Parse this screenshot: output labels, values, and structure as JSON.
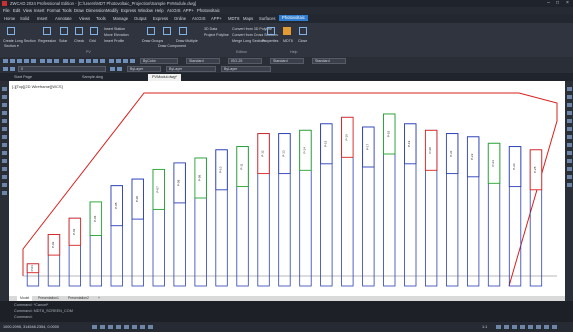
{
  "window": {
    "title": "ZWCAD 2024 Professional Edition - [C:\\Users\\MDT Photovoltaic_Projection\\Sample PVModule.dwg]",
    "controls": [
      "–",
      "□",
      "×"
    ]
  },
  "menubar": [
    "File",
    "Edit",
    "View",
    "Insert",
    "Format",
    "Tools",
    "Draw",
    "Dimension",
    "Modify",
    "Express",
    "Window",
    "Help",
    "ArcGIS",
    "APP+",
    "Photovoltaic"
  ],
  "ribbon_tabs": [
    "Home",
    "Solid",
    "Insert",
    "Annotate",
    "Views",
    "Tools",
    "Manage",
    "Output",
    "Express",
    "Online",
    "ArcGIS",
    "APP+",
    "MDT8",
    "Maps",
    "Surfaces",
    "Photovoltaic"
  ],
  "ribbon_active_tab": "Photovoltaic",
  "ribbon": {
    "buttons": [
      {
        "label": "Create Long Section",
        "sub": "Section ▾"
      },
      {
        "label": "Regression"
      },
      {
        "label": "Solar"
      },
      {
        "label": "Check"
      },
      {
        "label": "Grid"
      },
      {
        "label": "Insert Station"
      },
      {
        "label": "Move Elevation"
      },
      {
        "label": "Insert Profile"
      },
      {
        "label": "Draw Groups"
      },
      {
        "label": "Draw Component"
      },
      {
        "label": "Draw Multiple"
      },
      {
        "label": "3D Data"
      },
      {
        "label": "Project Polyline"
      },
      {
        "label": "Convert from 3D Polyline"
      },
      {
        "label": "Convert from Cross Sections"
      },
      {
        "label": "Merge Long Sections"
      },
      {
        "label": "Properties"
      },
      {
        "label": "MDT8"
      },
      {
        "label": "Close"
      }
    ],
    "groups": [
      "PV",
      "Edition",
      "Help"
    ]
  },
  "toolbar": {
    "layer_combo": "0",
    "color_combo": "ByLayer",
    "linetype_combo": "ByLayer",
    "lineweight_combo": "ByLayer",
    "plot_combo": "ByColor",
    "style_combo": "Standard",
    "dim_combo": "ISO-25",
    "table_combo": "Standard",
    "ml_combo": "Standard"
  },
  "doc_tabs": [
    "Start Page",
    "Sample.dwg",
    "PVModul.dwg*"
  ],
  "active_doc_tab": "PVModul.dwg*",
  "view_label": "[-][Top][2D Wireframe][WCS]",
  "layout_tabs": [
    "Model",
    "Presentation1",
    "Presentation2",
    "+"
  ],
  "active_layout_tab": "Model",
  "command_lines": [
    "Command:  *Cancel*",
    "Command:  MDT8_SCREEN_COM",
    "Command:"
  ],
  "status": {
    "coords": "1000.2095, 314548.2354, 0.0000",
    "scale": "1:1"
  },
  "colors": {
    "canvas_bg": "#ffffff",
    "table_blue": "#2a3fb8",
    "table_green": "#22a32a",
    "table_red": "#d8201c",
    "boundary": "#d8201c",
    "accent": "#2e7bcf"
  },
  "panels": [
    {
      "h": 0.0,
      "c": "red",
      "id": "P-01"
    },
    {
      "h": 0.18,
      "c": "red",
      "id": "P-02"
    },
    {
      "h": 0.28,
      "c": "red",
      "id": "P-03"
    },
    {
      "h": 0.38,
      "c": "green",
      "id": "P-04"
    },
    {
      "h": 0.48,
      "c": "blue",
      "id": "P-05"
    },
    {
      "h": 0.52,
      "c": "blue",
      "id": "P-06"
    },
    {
      "h": 0.58,
      "c": "green",
      "id": "P-07"
    },
    {
      "h": 0.62,
      "c": "blue",
      "id": "P-08"
    },
    {
      "h": 0.65,
      "c": "green",
      "id": "P-09"
    },
    {
      "h": 0.7,
      "c": "blue",
      "id": "P-10"
    },
    {
      "h": 0.72,
      "c": "green",
      "id": "P-11"
    },
    {
      "h": 0.8,
      "c": "red",
      "id": "P-12"
    },
    {
      "h": 0.8,
      "c": "blue",
      "id": "P-13"
    },
    {
      "h": 0.82,
      "c": "green",
      "id": "P-14"
    },
    {
      "h": 0.86,
      "c": "blue",
      "id": "P-15"
    },
    {
      "h": 0.9,
      "c": "red",
      "id": "P-16"
    },
    {
      "h": 0.84,
      "c": "blue",
      "id": "P-17"
    },
    {
      "h": 0.92,
      "c": "green",
      "id": "P-18"
    },
    {
      "h": 0.86,
      "c": "blue",
      "id": "P-19"
    },
    {
      "h": 0.82,
      "c": "red",
      "id": "P-20"
    },
    {
      "h": 0.8,
      "c": "blue",
      "id": "P-21"
    },
    {
      "h": 0.78,
      "c": "blue",
      "id": "P-22"
    },
    {
      "h": 0.74,
      "c": "green",
      "id": "P-23"
    },
    {
      "h": 0.72,
      "c": "blue",
      "id": "P-24"
    },
    {
      "h": 0.7,
      "c": "red",
      "id": "P-25"
    }
  ]
}
